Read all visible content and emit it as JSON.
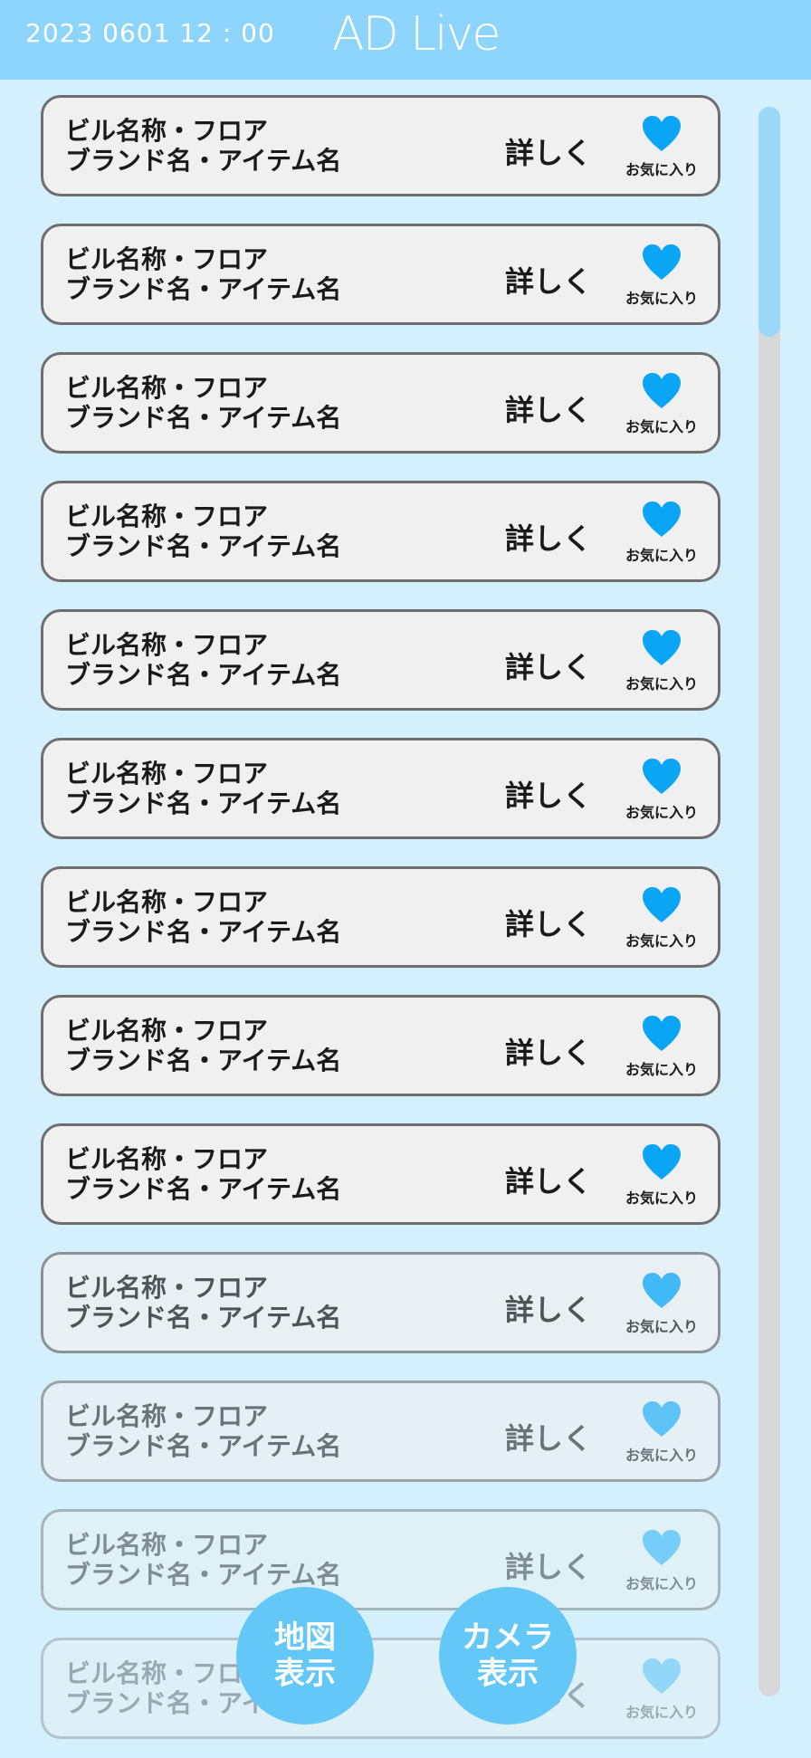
{
  "header": {
    "datetime": "2023  0601 12 : 00",
    "app_title": "AD Live"
  },
  "item_template": {
    "line1": "ビル名称・フロア",
    "line2": "ブランド名・アイテム名",
    "details_label": "詳しく",
    "favorite_label": "お気に入り"
  },
  "items": [
    {
      "line1": "ビル名称・フロア",
      "line2": "ブランド名・アイテム名",
      "details_label": "詳しく",
      "favorite_label": "お気に入り"
    },
    {
      "line1": "ビル名称・フロア",
      "line2": "ブランド名・アイテム名",
      "details_label": "詳しく",
      "favorite_label": "お気に入り"
    },
    {
      "line1": "ビル名称・フロア",
      "line2": "ブランド名・アイテム名",
      "details_label": "詳しく",
      "favorite_label": "お気に入り"
    },
    {
      "line1": "ビル名称・フロア",
      "line2": "ブランド名・アイテム名",
      "details_label": "詳しく",
      "favorite_label": "お気に入り"
    },
    {
      "line1": "ビル名称・フロア",
      "line2": "ブランド名・アイテム名",
      "details_label": "詳しく",
      "favorite_label": "お気に入り"
    },
    {
      "line1": "ビル名称・フロア",
      "line2": "ブランド名・アイテム名",
      "details_label": "詳しく",
      "favorite_label": "お気に入り"
    },
    {
      "line1": "ビル名称・フロア",
      "line2": "ブランド名・アイテム名",
      "details_label": "詳しく",
      "favorite_label": "お気に入り"
    },
    {
      "line1": "ビル名称・フロア",
      "line2": "ブランド名・アイテム名",
      "details_label": "詳しく",
      "favorite_label": "お気に入り"
    },
    {
      "line1": "ビル名称・フロア",
      "line2": "ブランド名・アイテム名",
      "details_label": "詳しく",
      "favorite_label": "お気に入り"
    },
    {
      "line1": "ビル名称・フロア",
      "line2": "ブランド名・アイテム名",
      "details_label": "詳しく",
      "favorite_label": "お気に入り"
    },
    {
      "line1": "ビル名称・フロア",
      "line2": "ブランド名・アイテム名",
      "details_label": "詳しく",
      "favorite_label": "お気に入り"
    },
    {
      "line1": "ビル名称・フロア",
      "line2": "ブランド名・アイテム名",
      "details_label": "詳しく",
      "favorite_label": "お気に入り"
    },
    {
      "line1": "ビル名称・フロア",
      "line2": "ブランド名・アイテム名",
      "details_label": "詳しく",
      "favorite_label": "お気に入り"
    }
  ],
  "buttons": {
    "map_label": "地図\n表示",
    "camera_label": "カメラ\n表示"
  },
  "icons": {
    "favorite": "heart-icon"
  },
  "colors": {
    "header_bg": "#8dd5fc",
    "page_bg": "#d4f0fd",
    "accent": "#0aa5f5",
    "fab_bg": "#63c8f8"
  }
}
